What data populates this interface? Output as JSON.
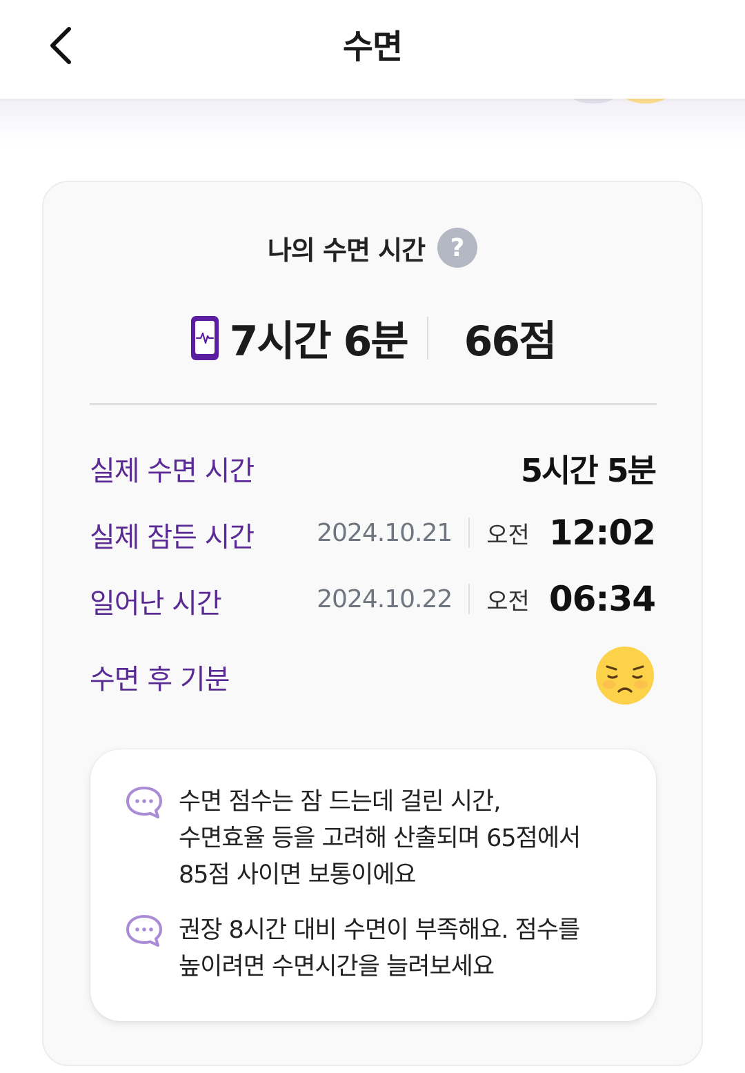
{
  "header": {
    "title": "수면"
  },
  "card": {
    "title": "나의 수면 시간",
    "summary": {
      "duration": "7시간 6분",
      "score": "66점"
    },
    "details": {
      "actual_sleep": {
        "label": "실제 수면 시간",
        "value": "5시간 5분"
      },
      "fell_asleep": {
        "label": "실제 잠든 시간",
        "date": "2024.10.21",
        "ampm": "오전",
        "time": "12:02"
      },
      "woke_up": {
        "label": "일어난 시간",
        "date": "2024.10.22",
        "ampm": "오전",
        "time": "06:34"
      },
      "mood": {
        "label": "수면 후 기분",
        "icon": "sad-face-icon"
      }
    },
    "info": [
      {
        "text": "수면 점수는 잠 드는데 걸린 시간,\n수면효율 등을 고려해 산출되며 65점에서\n85점 사이면 보통이에요"
      },
      {
        "text": "권장 8시간 대비 수면이 부족해요. 점수를\n높이려면 수면시간을 늘려보세요"
      }
    ]
  },
  "colors": {
    "accent_purple": "#5a2a94",
    "phone_icon": "#5b1ea0",
    "chat_icon": "#a98bd6",
    "help_icon": "#b3b8c3",
    "mood_face": "#fcd24a"
  }
}
